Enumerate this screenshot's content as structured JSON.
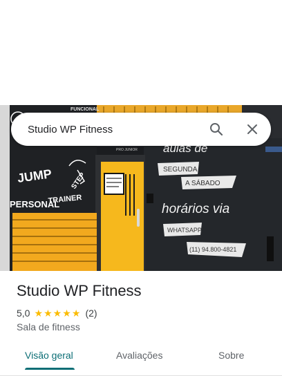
{
  "search": {
    "query": "Studio WP Fitness"
  },
  "place": {
    "name": "Studio WP Fitness",
    "rating": "5,0",
    "stars": 5,
    "review_count": "(2)",
    "category": "Sala de fitness"
  },
  "tabs": [
    {
      "label": "Visão geral",
      "active": true
    },
    {
      "label": "Avaliações",
      "active": false
    },
    {
      "label": "Sobre",
      "active": false
    }
  ],
  "mural": {
    "left_words": [
      "JUMP",
      "PERSONAL",
      "TRAINER",
      "STEP",
      "FUNCIONAL"
    ],
    "door_label": "PRO JUNIOR",
    "right_lines": [
      "aulas de",
      "SEGUNDA",
      "A SÁBADO",
      "horários via",
      "WHATSAPP",
      "(11) 94.800-4821"
    ]
  },
  "colors": {
    "accent": "#0b6e75",
    "star": "#fbbc04",
    "door": "#f6b81d",
    "wall": "#24272b"
  }
}
